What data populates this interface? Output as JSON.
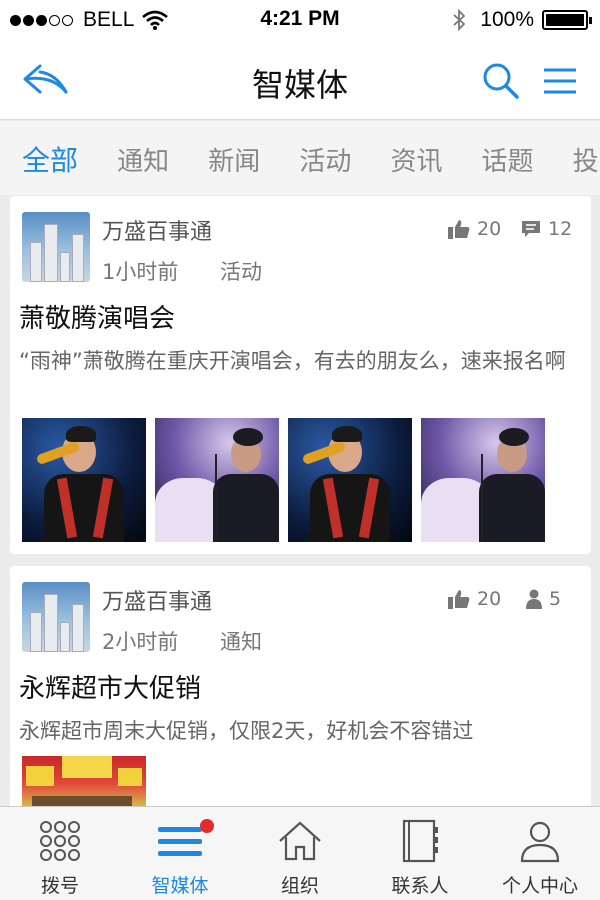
{
  "status_bar": {
    "carrier": "BELL",
    "time": "4:21 PM",
    "battery": "100%",
    "signal_bars": 3,
    "signal_total": 5
  },
  "nav": {
    "title": "智媒体",
    "back_icon": "back-arrow-icon",
    "search_icon": "search-icon",
    "menu_icon": "menu-icon"
  },
  "tabs": [
    {
      "label": "全部",
      "active": true
    },
    {
      "label": "通知",
      "active": false
    },
    {
      "label": "新闻",
      "active": false
    },
    {
      "label": "活动",
      "active": false
    },
    {
      "label": "资讯",
      "active": false
    },
    {
      "label": "话题",
      "active": false
    },
    {
      "label": "投票",
      "active": false
    }
  ],
  "posts": [
    {
      "publisher": "万盛百事通",
      "time": "1小时前",
      "category": "活动",
      "likes": "20",
      "comments": "12",
      "title": "萧敬腾演唱会",
      "body": "“雨神”萧敬腾在重庆开演唱会，有去的朋友么，速来报名啊",
      "images": 4
    },
    {
      "publisher": "万盛百事通",
      "time": "2小时前",
      "category": "通知",
      "likes": "20",
      "participants": "5",
      "title": "永辉超市大促销",
      "body": "永辉超市周末大促销，仅限2天，好机会不容错过",
      "images": 1
    }
  ],
  "tab_bar": [
    {
      "label": "拨号",
      "icon": "dialpad-icon",
      "active": false
    },
    {
      "label": "智媒体",
      "icon": "media-list-icon",
      "active": true,
      "badge": true
    },
    {
      "label": "组织",
      "icon": "home-icon",
      "active": false
    },
    {
      "label": "联系人",
      "icon": "address-book-icon",
      "active": false
    },
    {
      "label": "个人中心",
      "icon": "user-icon",
      "active": false
    }
  ],
  "colors": {
    "accent": "#1e88e5",
    "badge": "#e52b2b",
    "background": "#ececec"
  }
}
